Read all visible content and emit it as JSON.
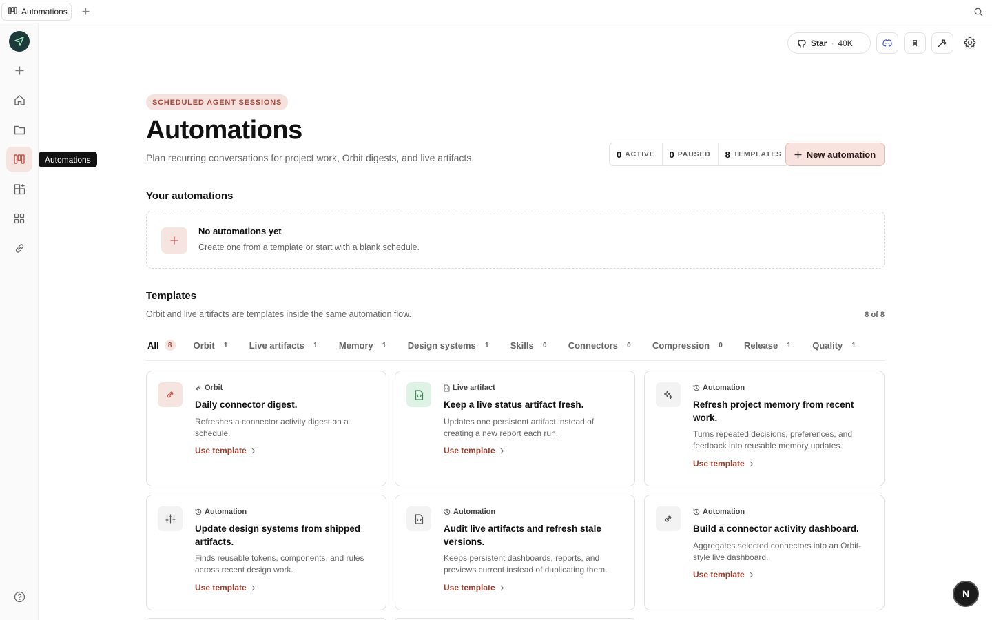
{
  "tab": {
    "title": "Automations"
  },
  "sidebar": {
    "tooltip": "Automations",
    "items": [
      {
        "name": "new",
        "icon": "plus-icon"
      },
      {
        "name": "home",
        "icon": "home-icon"
      },
      {
        "name": "projects",
        "icon": "folder-icon"
      },
      {
        "name": "automations",
        "icon": "automations-icon",
        "active": true
      },
      {
        "name": "add-widget",
        "icon": "widget-add-icon"
      },
      {
        "name": "apps",
        "icon": "grid-icon"
      },
      {
        "name": "connectors",
        "icon": "link-icon"
      }
    ],
    "help_icon": "help-icon"
  },
  "top_actions": {
    "star_label": "Star",
    "star_separator": "·",
    "star_count": "40K"
  },
  "header": {
    "kicker": "SCHEDULED AGENT SESSIONS",
    "title": "Automations",
    "subtitle": "Plan recurring conversations for project work, Orbit digests, and live artifacts.",
    "stats": [
      {
        "value": "0",
        "label": "ACTIVE"
      },
      {
        "value": "0",
        "label": "PAUSED"
      },
      {
        "value": "8",
        "label": "TEMPLATES"
      }
    ],
    "new_button": "New automation"
  },
  "your_automations": {
    "title": "Your automations",
    "empty_title": "No automations yet",
    "empty_desc": "Create one from a template or start with a blank schedule."
  },
  "templates": {
    "title": "Templates",
    "desc": "Orbit and live artifacts are templates inside the same automation flow.",
    "count": "8 of 8",
    "filters": [
      {
        "label": "All",
        "count": "8",
        "active": true
      },
      {
        "label": "Orbit",
        "count": "1"
      },
      {
        "label": "Live artifacts",
        "count": "1"
      },
      {
        "label": "Memory",
        "count": "1"
      },
      {
        "label": "Design systems",
        "count": "1"
      },
      {
        "label": "Skills",
        "count": "0"
      },
      {
        "label": "Connectors",
        "count": "0"
      },
      {
        "label": "Compression",
        "count": "0"
      },
      {
        "label": "Release",
        "count": "1"
      },
      {
        "label": "Quality",
        "count": "1"
      }
    ],
    "use_label": "Use template",
    "cards": [
      {
        "kind": "Orbit",
        "title": "Daily connector digest.",
        "desc": "Refreshes a connector activity digest on a schedule.",
        "icon": "link-icon",
        "tone": "rose"
      },
      {
        "kind": "Live artifact",
        "title": "Keep a live status artifact fresh.",
        "desc": "Updates one persistent artifact instead of creating a new report each run.",
        "icon": "code-file-icon",
        "tone": "mint"
      },
      {
        "kind": "Automation",
        "title": "Refresh project memory from recent work.",
        "desc": "Turns repeated decisions, preferences, and feedback into reusable memory updates.",
        "icon": "sparkle-icon",
        "tone": "gray"
      },
      {
        "kind": "Automation",
        "title": "Update design systems from shipped artifacts.",
        "desc": "Finds reusable tokens, components, and rules across recent design work.",
        "icon": "sliders-icon",
        "tone": "gray"
      },
      {
        "kind": "Automation",
        "title": "Audit live artifacts and refresh stale versions.",
        "desc": "Keeps persistent dashboards, reports, and previews current instead of duplicating them.",
        "icon": "code-file-icon",
        "tone": "gray"
      },
      {
        "kind": "Automation",
        "title": "Build a connector activity dashboard.",
        "desc": "Aggregates selected connectors into an Orbit-style live dashboard.",
        "icon": "link-icon",
        "tone": "gray"
      }
    ]
  },
  "fab": {
    "label": "N"
  },
  "colors": {
    "accent": "#c0544a",
    "accent_bg": "#f6e4e1",
    "link": "#9b3f30"
  }
}
